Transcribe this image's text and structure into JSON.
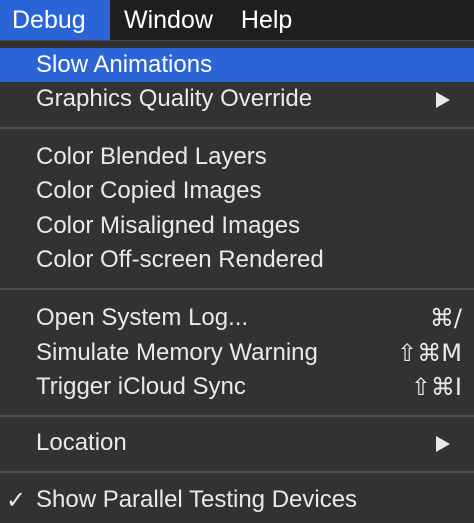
{
  "menubar": {
    "items": [
      "Debug",
      "Window",
      "Help"
    ],
    "active_index": 0
  },
  "menu": {
    "items": [
      {
        "label": "Slow Animations",
        "highlighted": true
      },
      {
        "label": "Graphics Quality Override",
        "submenu": true
      },
      {
        "label": "Color Blended Layers"
      },
      {
        "label": "Color Copied Images"
      },
      {
        "label": "Color Misaligned Images"
      },
      {
        "label": "Color Off-screen Rendered"
      },
      {
        "label": "Open System Log...",
        "shortcut": "⌘/"
      },
      {
        "label": "Simulate Memory Warning",
        "shortcut": "⇧⌘M"
      },
      {
        "label": "Trigger iCloud Sync",
        "shortcut": "⇧⌘I"
      },
      {
        "label": "Location",
        "submenu": true
      },
      {
        "label": "Show Parallel Testing Devices",
        "checked": true,
        "check_glyph": "✓"
      }
    ]
  },
  "colors": {
    "highlight": "#2a64d6",
    "menu_background": "#323233",
    "menubar_background": "#1e1e1e",
    "text": "#e9e9e9"
  },
  "icons": {
    "submenu": "chevron-right-icon",
    "check": "checkmark-icon"
  }
}
